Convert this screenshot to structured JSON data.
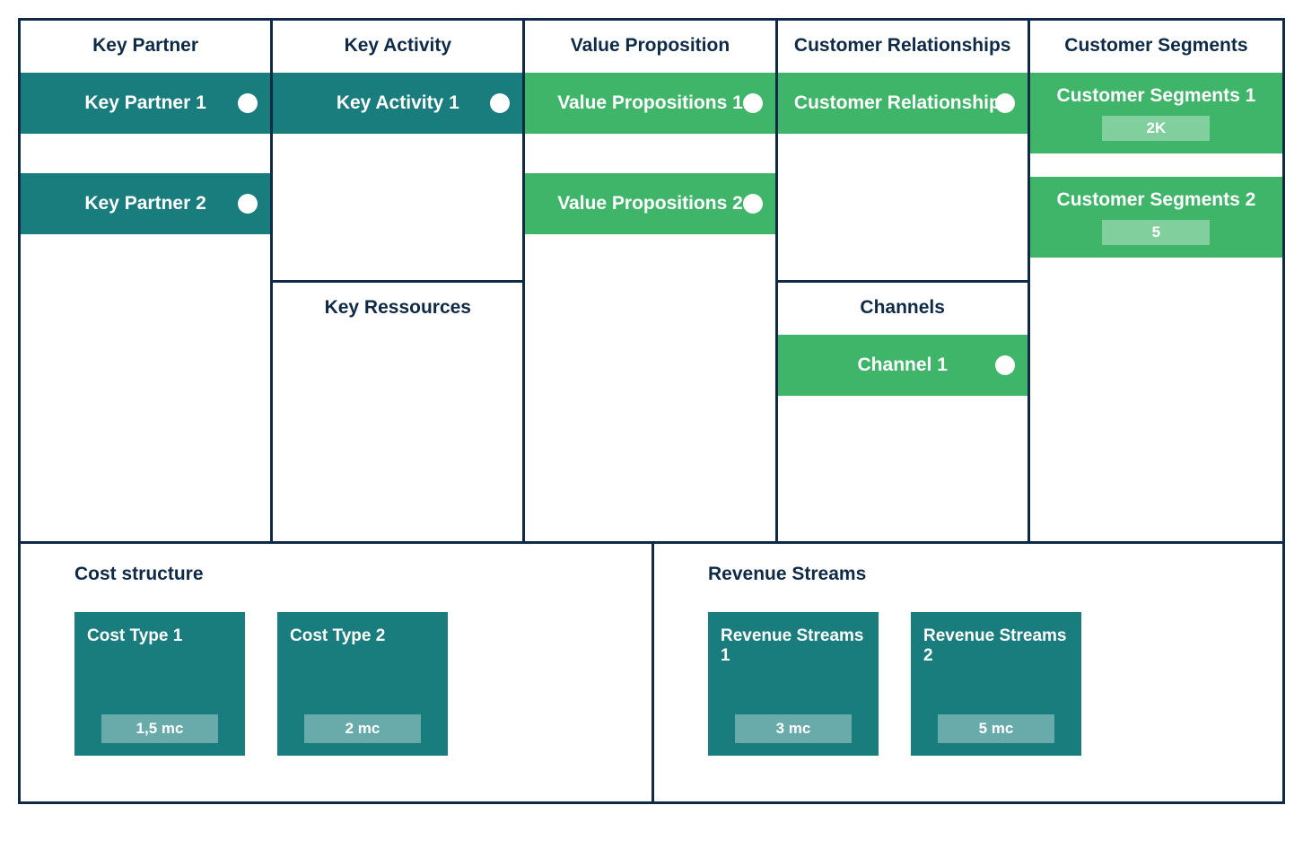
{
  "keyPartner": {
    "header": "Key Partner",
    "items": [
      {
        "label": "Key Partner 1"
      },
      {
        "label": "Key Partner 2"
      }
    ]
  },
  "keyActivity": {
    "header": "Key Activity",
    "items": [
      {
        "label": "Key Activity 1"
      }
    ]
  },
  "keyRessources": {
    "header": "Key Ressources"
  },
  "valueProposition": {
    "header": "Value Proposition",
    "items": [
      {
        "label": "Value Propositions 1"
      },
      {
        "label": "Value Propositions 2"
      }
    ]
  },
  "customerRelationships": {
    "header": "Customer Relationships",
    "items": [
      {
        "label": "Customer Relationships"
      }
    ]
  },
  "channels": {
    "header": "Channels",
    "items": [
      {
        "label": "Channel 1"
      }
    ]
  },
  "customerSegments": {
    "header": "Customer Segments",
    "items": [
      {
        "label": "Customer Segments 1",
        "badge": "2K"
      },
      {
        "label": "Customer Segments 2",
        "badge": "5"
      }
    ]
  },
  "costStructure": {
    "header": "Cost structure",
    "cards": [
      {
        "title": "Cost Type 1",
        "badge": "1,5 mc"
      },
      {
        "title": "Cost Type 2",
        "badge": "2 mc"
      }
    ]
  },
  "revenueStreams": {
    "header": "Revenue Streams",
    "cards": [
      {
        "title": "Revenue Streams 1",
        "badge": "3 mc"
      },
      {
        "title": "Revenue Streams 2",
        "badge": "5 mc"
      }
    ]
  }
}
